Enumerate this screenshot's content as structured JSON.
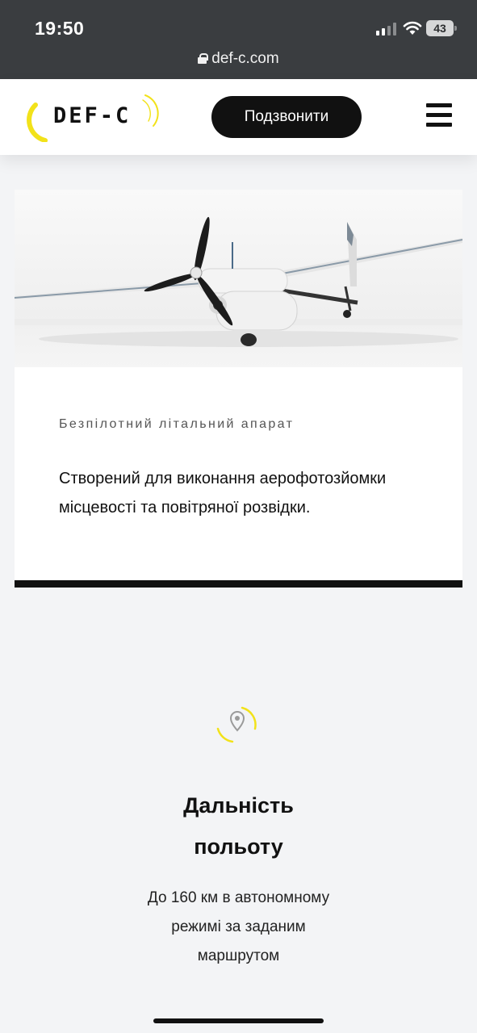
{
  "status": {
    "time": "19:50",
    "battery": "43"
  },
  "browser": {
    "url": "def-c.com"
  },
  "header": {
    "logo_text": "DEF-C",
    "call_label": "Подзвонити"
  },
  "product": {
    "kicker": "Безпілотний літальний апарат",
    "description": "Створений для виконання аерофотозйомки місцевості та повітряної розвідки."
  },
  "feature": {
    "title_line1": "Дальність",
    "title_line2": "польоту",
    "desc_line1": "До 160 км в автономному",
    "desc_line2": "режимі за заданим",
    "desc_line3": "маршрутом"
  },
  "colors": {
    "accent": "#f2e21a",
    "dark": "#111111",
    "status_bar": "#3a3d40"
  }
}
